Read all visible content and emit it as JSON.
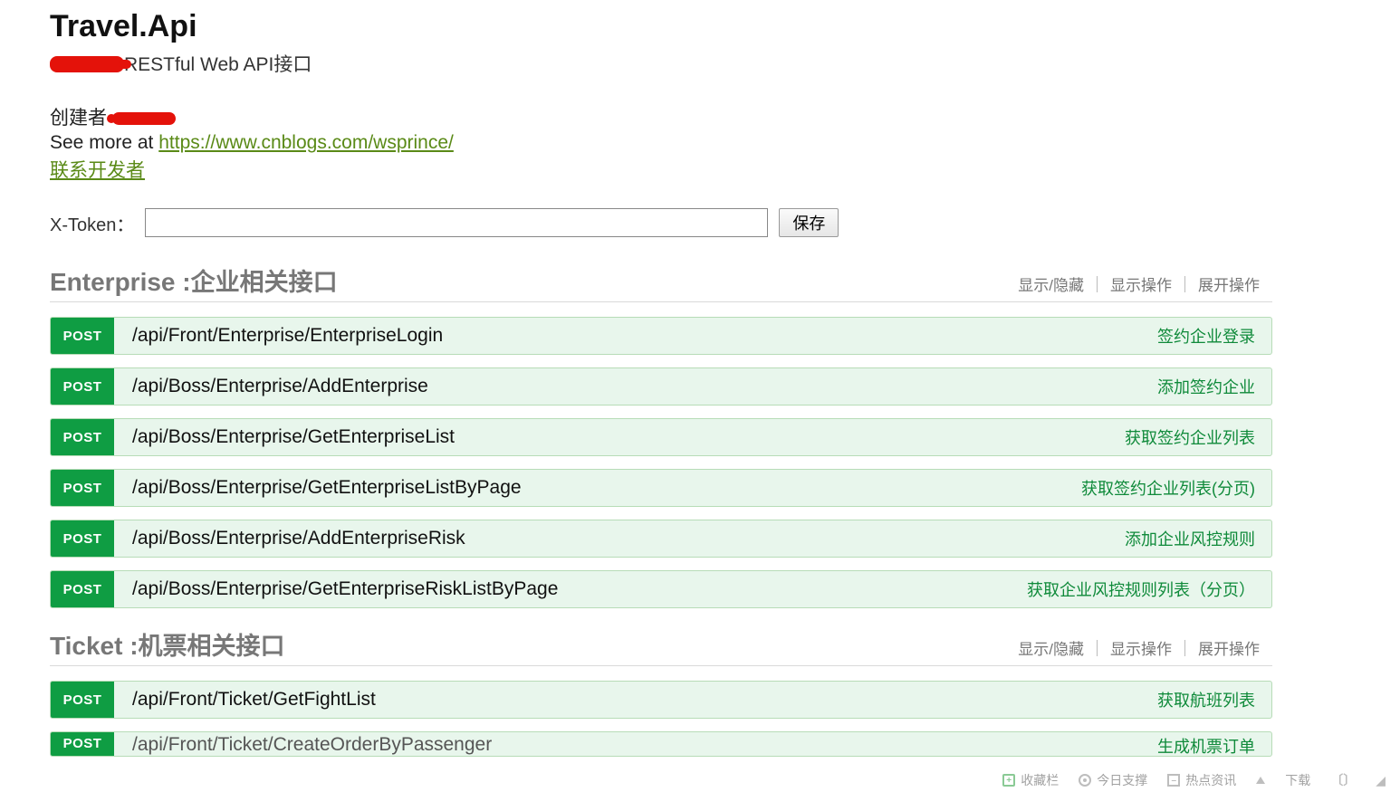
{
  "header": {
    "title": "Travel.Api",
    "subtitle_suffix": "RESTful Web API接口",
    "creator_label": "创建者",
    "see_more_prefix": "See more at ",
    "see_more_url": "https://www.cnblogs.com/wsprince/",
    "contact_label": "联系开发者"
  },
  "token": {
    "label": "X-Token：",
    "value": "",
    "save_label": "保存"
  },
  "section_actions": {
    "toggle": "显示/隐藏",
    "show_ops": "显示操作",
    "expand_ops": "展开操作"
  },
  "sections": [
    {
      "name": "Enterprise",
      "separator": " : ",
      "desc": "企业相关接口",
      "ops": [
        {
          "method": "POST",
          "path": "/api/Front/Enterprise/EnterpriseLogin",
          "desc": "签约企业登录"
        },
        {
          "method": "POST",
          "path": "/api/Boss/Enterprise/AddEnterprise",
          "desc": "添加签约企业"
        },
        {
          "method": "POST",
          "path": "/api/Boss/Enterprise/GetEnterpriseList",
          "desc": "获取签约企业列表"
        },
        {
          "method": "POST",
          "path": "/api/Boss/Enterprise/GetEnterpriseListByPage",
          "desc": "获取签约企业列表(分页)"
        },
        {
          "method": "POST",
          "path": "/api/Boss/Enterprise/AddEnterpriseRisk",
          "desc": "添加企业风控规则"
        },
        {
          "method": "POST",
          "path": "/api/Boss/Enterprise/GetEnterpriseRiskListByPage",
          "desc": "获取企业风控规则列表（分页）"
        }
      ]
    },
    {
      "name": "Ticket",
      "separator": " : ",
      "desc": "机票相关接口",
      "ops": [
        {
          "method": "POST",
          "path": "/api/Front/Ticket/GetFightList",
          "desc": "获取航班列表"
        },
        {
          "method": "POST",
          "path": "/api/Front/Ticket/CreateOrderByPassenger",
          "desc": "生成机票订单",
          "cut": true
        }
      ]
    }
  ],
  "bottom_bar": {
    "items": [
      "收藏栏",
      "今日支撑",
      "热点资讯",
      "",
      "下载",
      ""
    ]
  }
}
